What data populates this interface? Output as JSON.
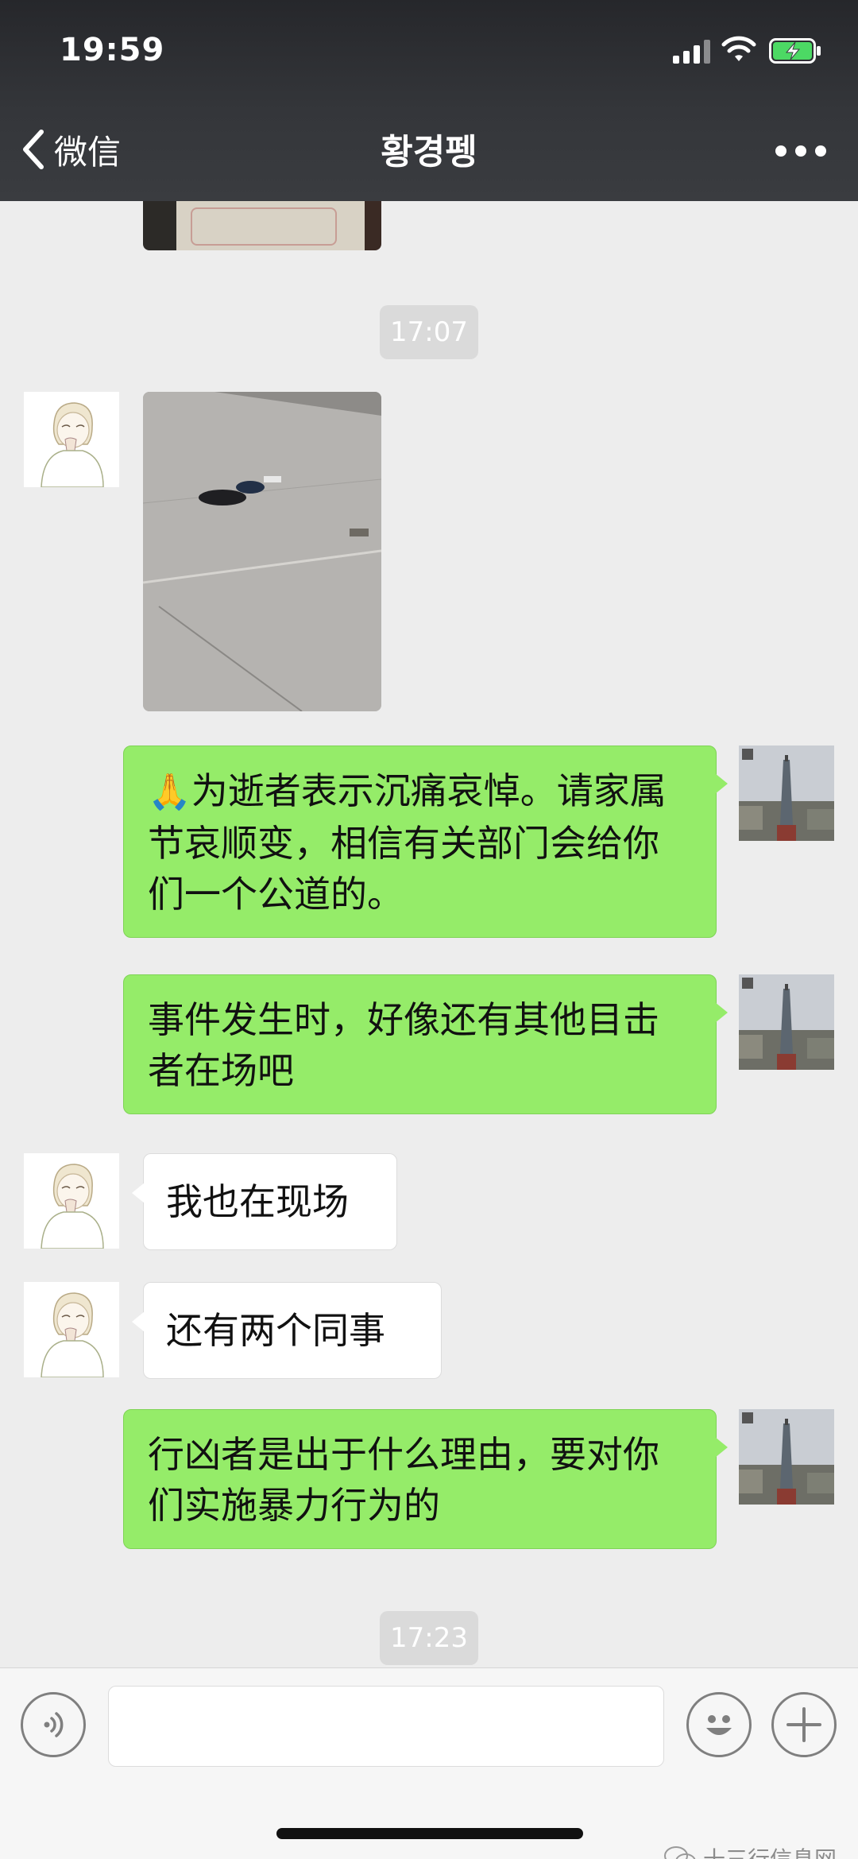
{
  "status_bar": {
    "time": "19:59",
    "icons": [
      "signal-icon",
      "wifi-icon",
      "battery-charging-icon"
    ]
  },
  "nav": {
    "back_label": "微信",
    "title": "황경펭",
    "more_icon": "more-dots-icon"
  },
  "chat": {
    "timestamps": [
      "17:07",
      "17:23"
    ],
    "messages": [
      {
        "sender": "them",
        "kind": "image",
        "description_icon": "photo-thumbnail"
      },
      {
        "sender": "me",
        "kind": "text",
        "emoji": "🙏",
        "text": "为逝者表示沉痛哀悼。请家属节哀顺变，相信有关部门会给你们一个公道的。"
      },
      {
        "sender": "me",
        "kind": "text",
        "text": "事件发生时，好像还有其他目击者在场吧"
      },
      {
        "sender": "them",
        "kind": "text",
        "text": "我也在现场"
      },
      {
        "sender": "them",
        "kind": "text",
        "text": "还有两个同事"
      },
      {
        "sender": "me",
        "kind": "text",
        "text": "行凶者是出于什么理由，要对你们实施暴力行为的"
      }
    ]
  },
  "input_bar": {
    "voice_icon": "voice-icon",
    "emoji_icon": "emoji-icon",
    "add_icon": "plus-icon"
  },
  "watermark": {
    "text": "十三行信息网"
  },
  "colors": {
    "chat_background": "#ededed",
    "my_bubble": "#95ec69",
    "their_bubble": "#ffffff",
    "nav_background": "#37383c"
  }
}
